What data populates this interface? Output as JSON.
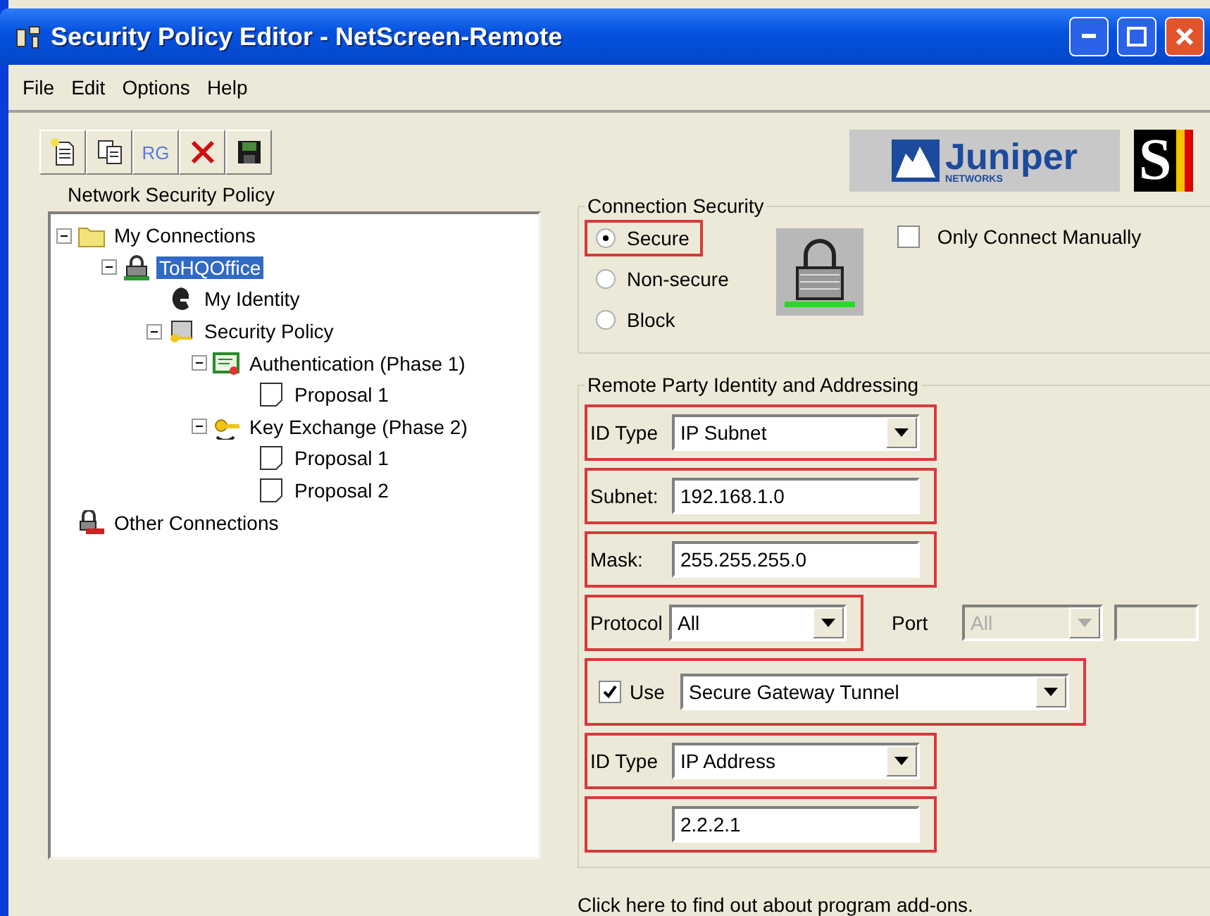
{
  "window": {
    "title": "Security Policy Editor - NetScreen-Remote"
  },
  "menu": [
    "File",
    "Edit",
    "Options",
    "Help"
  ],
  "toolbar": [
    {
      "kind": "new"
    },
    {
      "kind": "copy"
    },
    {
      "kind": "text",
      "label": "RG"
    },
    {
      "kind": "delete"
    },
    {
      "kind": "save"
    }
  ],
  "logos": {
    "brand": "Juniper",
    "brand_sub": "NETWORKS",
    "mark": "S"
  },
  "tree": {
    "title": "Network Security Policy",
    "items": [
      {
        "label": "My Connections",
        "kind": "folder",
        "selected": false,
        "expanded": true,
        "children": [
          {
            "label": "ToHQOffice",
            "kind": "connection",
            "selected": true,
            "expanded": true,
            "children": [
              {
                "label": "My Identity",
                "kind": "identity",
                "selected": false
              },
              {
                "label": "Security Policy",
                "kind": "policy",
                "selected": false,
                "expanded": true,
                "children": [
                  {
                    "label": "Authentication (Phase 1)",
                    "kind": "certificate",
                    "selected": false,
                    "expanded": true,
                    "children": [
                      {
                        "label": "Proposal 1",
                        "kind": "document",
                        "selected": false
                      }
                    ]
                  },
                  {
                    "label": "Key Exchange (Phase 2)",
                    "kind": "key",
                    "selected": false,
                    "expanded": true,
                    "children": [
                      {
                        "label": "Proposal 1",
                        "kind": "document",
                        "selected": false
                      },
                      {
                        "label": "Proposal 2",
                        "kind": "document",
                        "selected": false
                      }
                    ]
                  }
                ]
              }
            ]
          }
        ]
      },
      {
        "label": "Other Connections",
        "kind": "other",
        "selected": false
      }
    ]
  },
  "connection_security": {
    "title": "Connection Security",
    "options": [
      {
        "label": "Secure",
        "selected": true,
        "highlighted": true
      },
      {
        "label": "Non-secure",
        "selected": false,
        "highlighted": false
      },
      {
        "label": "Block",
        "selected": false,
        "highlighted": false
      }
    ],
    "only_connect_manually": {
      "label": "Only Connect Manually",
      "checked": false
    }
  },
  "remote_party": {
    "title": "Remote Party Identity and Addressing",
    "rows": [
      {
        "kind": "dropdown",
        "label": "ID Type",
        "value": "IP Subnet",
        "highlighted": true
      },
      {
        "kind": "text",
        "label": "Subnet:",
        "value": "192.168.1.0",
        "highlighted": true
      },
      {
        "kind": "text",
        "label": "Mask:",
        "value": "255.255.255.0",
        "highlighted": true
      },
      {
        "kind": "protocol",
        "label": "Protocol",
        "value": "All",
        "highlighted": true,
        "port": {
          "label": "Port",
          "value": "All",
          "disabled": true
        }
      },
      {
        "kind": "gateway",
        "label": "Use",
        "checked": true,
        "value": "Secure Gateway Tunnel",
        "highlighted": true
      },
      {
        "kind": "dropdown",
        "label": "ID Type",
        "value": "IP Address",
        "highlighted": true
      },
      {
        "kind": "text",
        "value": "2.2.2.1",
        "highlighted": true
      }
    ]
  },
  "footer": "Click here to find out about program add-ons."
}
